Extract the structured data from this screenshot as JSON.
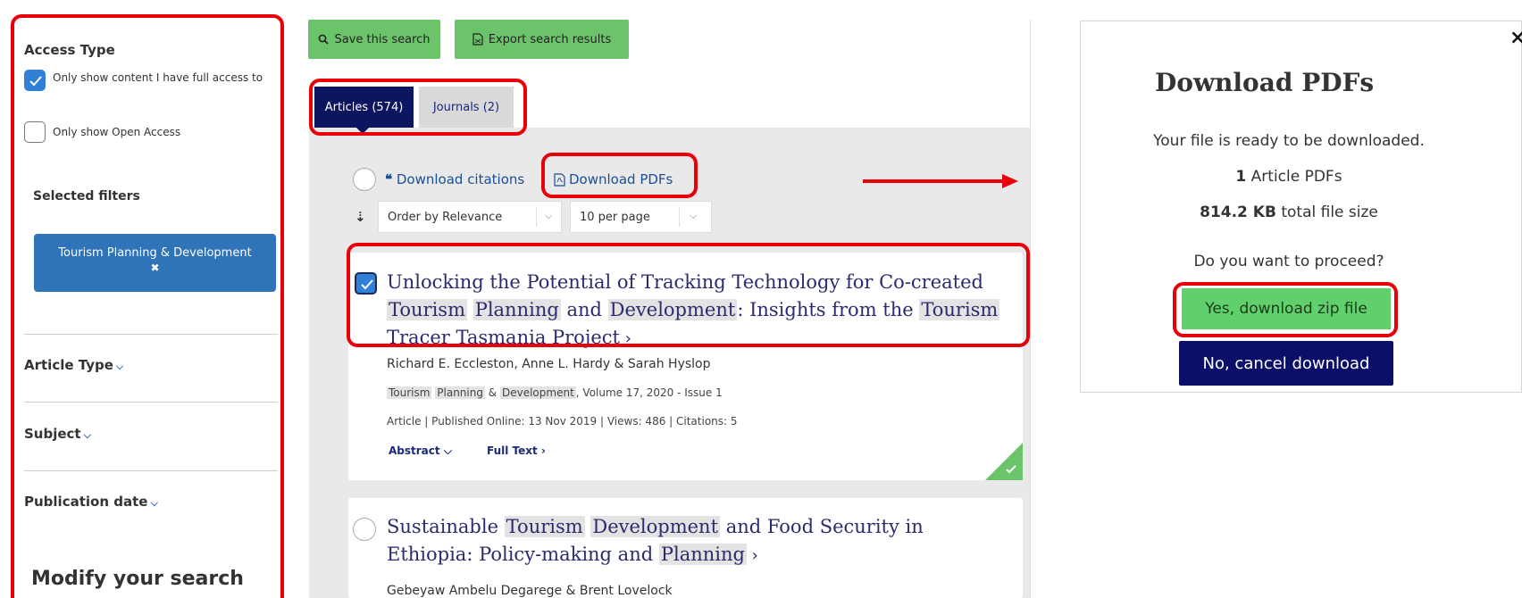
{
  "sidebar": {
    "access_type_heading": "Access Type",
    "full_access_label": "Only show content I have full access to",
    "full_access_checked": true,
    "open_access_label": "Only show Open Access",
    "open_access_checked": false,
    "selected_filters_heading": "Selected filters",
    "filter_chip_label": "Tourism Planning & Development",
    "filter_chip_remove": "✖",
    "article_type_label": "Article Type",
    "subject_label": "Subject",
    "publication_date_label": "Publication date",
    "modify_search_label": "Modify your search"
  },
  "toolbar": {
    "save_search_label": "Save this search",
    "export_label": "Export search results"
  },
  "tabs": [
    {
      "label": "Articles",
      "count": "(574)",
      "active": true
    },
    {
      "label": "Journals",
      "count": "(2)",
      "active": false
    }
  ],
  "actions": {
    "download_citations_label": "Download citations",
    "download_pdfs_label": "Download PDFs",
    "order_by_value": "Order by Relevance",
    "per_page_value": "10 per page"
  },
  "results": [
    {
      "checked": true,
      "title_parts": [
        {
          "t": "Unlocking the Potential of Tracking Technology for Co-created ",
          "hl": false
        },
        {
          "t": "Tourism",
          "hl": true
        },
        {
          "t": " ",
          "hl": false
        },
        {
          "t": "Planning",
          "hl": true
        },
        {
          "t": " and ",
          "hl": false
        },
        {
          "t": "Development",
          "hl": true
        },
        {
          "t": ": Insights from the ",
          "hl": false
        },
        {
          "t": "Tourism",
          "hl": true
        },
        {
          "t": " Tracer Tasmania Project",
          "hl": false
        }
      ],
      "authors": "Richard E. Eccleston, Anne L. Hardy & Sarah Hyslop",
      "journal_parts": [
        {
          "t": "Tourism",
          "hl": true
        },
        {
          "t": " ",
          "hl": false
        },
        {
          "t": "Planning",
          "hl": true
        },
        {
          "t": " & ",
          "hl": false
        },
        {
          "t": "Development",
          "hl": true
        },
        {
          "t": ", Volume 17, 2020 - Issue 1",
          "hl": false
        }
      ],
      "meta": "Article | Published Online: 13 Nov 2019 | Views: 486 | Citations: 5",
      "abstract_label": "Abstract",
      "fulltext_label": "Full Text"
    },
    {
      "checked": false,
      "title_parts": [
        {
          "t": "Sustainable ",
          "hl": false
        },
        {
          "t": "Tourism",
          "hl": true
        },
        {
          "t": " ",
          "hl": false
        },
        {
          "t": "Development",
          "hl": true
        },
        {
          "t": " and Food Security in Ethiopia: Policy-making and ",
          "hl": false
        },
        {
          "t": "Planning",
          "hl": true
        }
      ],
      "authors": "Gebeyaw Ambelu Degarege & Brent Lovelock"
    }
  ],
  "modal": {
    "title": "Download PDFs",
    "ready_text": "Your file is ready to be downloaded.",
    "count_bold": "1",
    "count_text": " Article PDFs",
    "size_bold": "814.2 KB",
    "size_text": " total file size",
    "question": "Do you want to proceed?",
    "yes_label": "Yes, download zip file",
    "no_label": "No, cancel download",
    "close_label": "×"
  },
  "colors": {
    "annotation_red": "#e8000b",
    "green_button": "#6cc46a",
    "navy": "#0c0f6a",
    "chip_blue": "#2f73b8",
    "checkbox_blue": "#2f80d6"
  }
}
